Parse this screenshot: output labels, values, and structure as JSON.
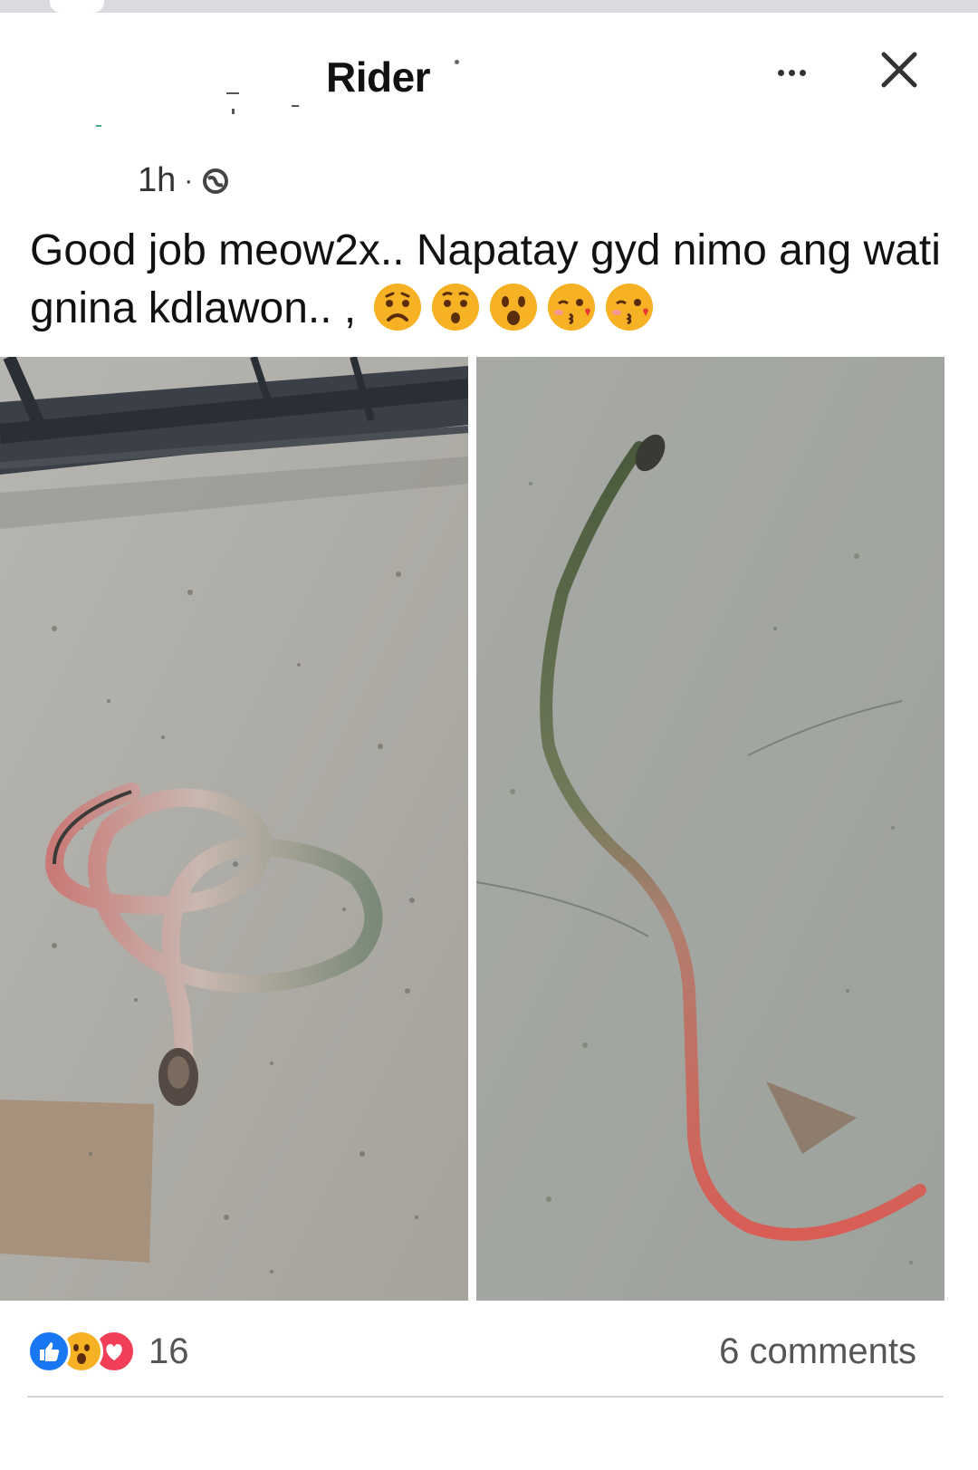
{
  "post": {
    "author_name": "Rider",
    "timestamp": "1h",
    "meta_separator": "·",
    "privacy_icon": "globe-icon",
    "text": "Good job meow2x.. Napatay gyd nimo ang wati gnina kdlawon.. ,",
    "emojis": [
      "worried-face",
      "hushed-face",
      "astonished-face",
      "face-blowing-kiss",
      "face-blowing-kiss"
    ],
    "photos": [
      {
        "name": "photo-coiled-snake"
      },
      {
        "name": "photo-stretched-snake"
      }
    ]
  },
  "header": {
    "more_icon": "more-options-icon",
    "close_icon": "close-icon"
  },
  "footer": {
    "reaction_icons": [
      "like-icon",
      "wow-icon",
      "love-icon"
    ],
    "reaction_count": "16",
    "comments": "6 comments"
  },
  "colors": {
    "like_blue": "#1877f2",
    "love_red": "#f33e58",
    "wow_yellow": "#f7b125",
    "text_dark": "#111111",
    "text_muted": "#555555"
  }
}
